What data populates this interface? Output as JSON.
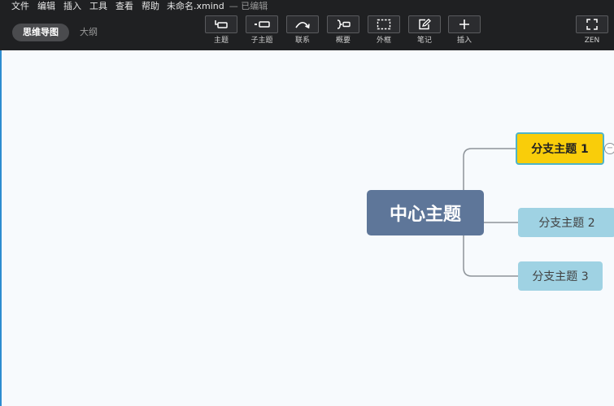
{
  "menubar": {
    "items": [
      "文件",
      "编辑",
      "插入",
      "工具",
      "查看",
      "帮助"
    ],
    "file_title": "未命名.xmind",
    "file_status": "— 已编辑"
  },
  "view_switch": {
    "tabs": [
      {
        "label": "思维导图",
        "active": true
      },
      {
        "label": "大纲",
        "active": false
      }
    ]
  },
  "toolbar": {
    "topic": "主题",
    "subtopic": "子主题",
    "relationship": "联系",
    "summary": "概要",
    "boundary": "外框",
    "note": "笔记",
    "insert": "插入",
    "zen": "ZEN"
  },
  "map": {
    "central": "中心主题",
    "branches": [
      "分支主题 1",
      "分支主题 2",
      "分支主题 3"
    ],
    "selected_branch": "分支主题 1",
    "collapse_symbol": "−"
  },
  "colors": {
    "toolbar_bg": "#1f2022",
    "canvas_bg": "#f7fafd",
    "central_topic": "#5e7699",
    "branch_topic": "#9fd2e3",
    "selected_topic": "#f9cd0a",
    "selection_border": "#4fb4c8"
  }
}
